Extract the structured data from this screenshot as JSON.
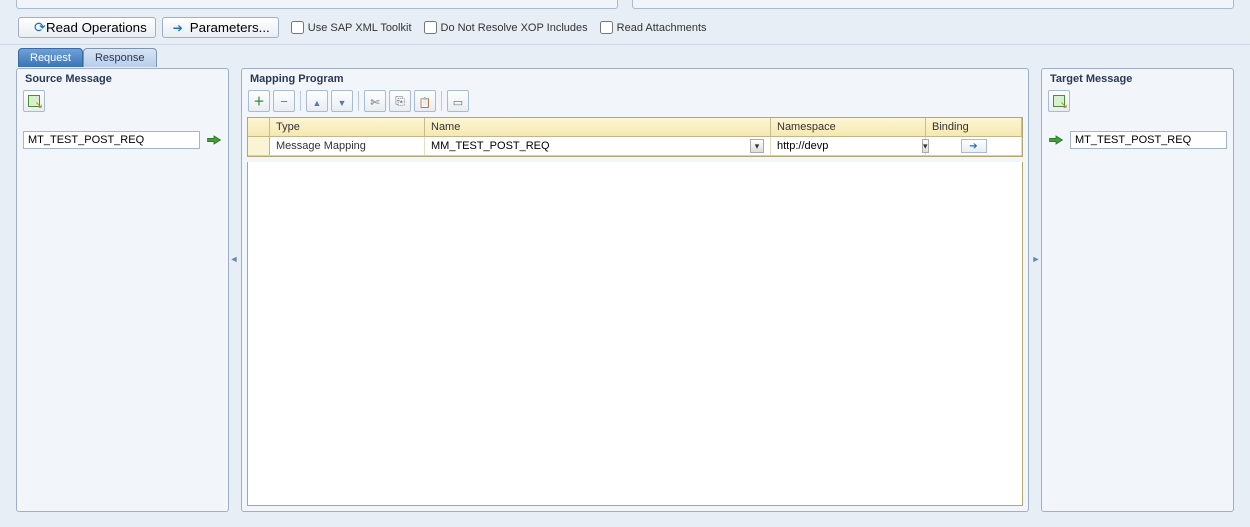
{
  "toolbar": {
    "read_ops_label": "Read Operations",
    "parameters_label": "Parameters...",
    "chk_sap_xml": "Use SAP XML Toolkit",
    "chk_no_xop": "Do Not Resolve XOP Includes",
    "chk_read_attach": "Read Attachments"
  },
  "tabs": {
    "request": "Request",
    "response": "Response",
    "active": "request"
  },
  "source": {
    "title": "Source Message",
    "msg_type": "MT_TEST_POST_REQ"
  },
  "mapping": {
    "title": "Mapping Program",
    "cols": {
      "type": "Type",
      "name": "Name",
      "ns": "Namespace",
      "bind": "Binding"
    },
    "rows": [
      {
        "type": "Message Mapping",
        "name": "MM_TEST_POST_REQ",
        "ns": "http://devp"
      }
    ]
  },
  "target": {
    "title": "Target Message",
    "msg_type": "MT_TEST_POST_REQ"
  }
}
